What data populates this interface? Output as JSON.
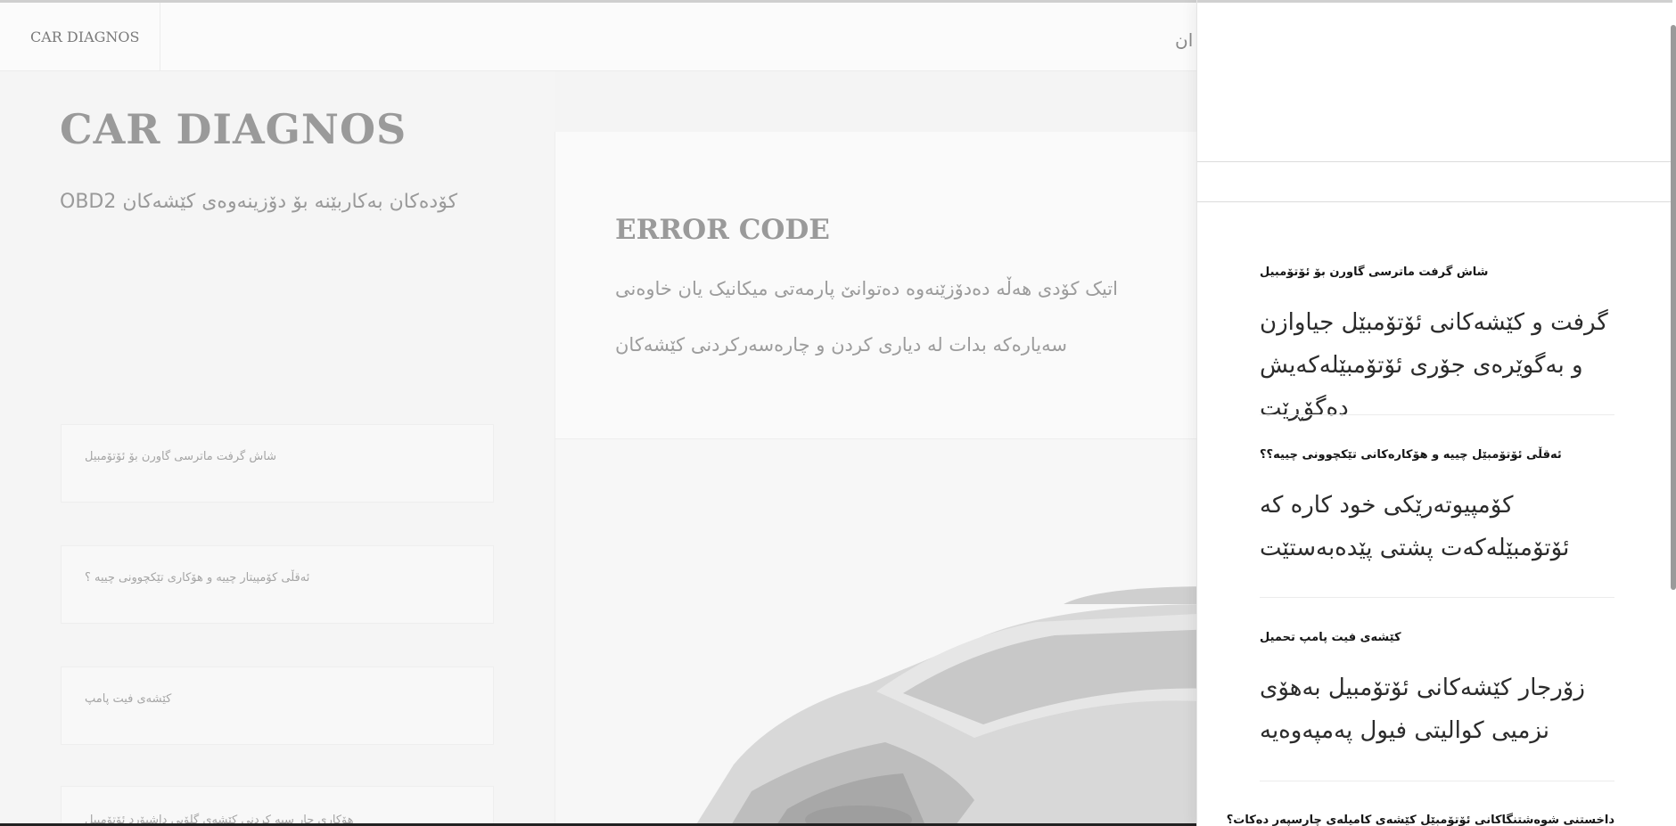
{
  "navbar": {
    "brand": "CAR DIAGNOS",
    "partial_link": "ان"
  },
  "hero": {
    "title": "CAR DIAGNOS",
    "subtitle": "کۆدەکان بەکاربێنە بۆ دۆزینەوەی کێشەکان OBD2"
  },
  "sidebar_cards": [
    "شاش گرفت ماترسی گاورن بۆ ئۆتۆمبیل",
    "ئەقڵی کۆمپیتار چییە و هۆکاری تێکچوونی چییە ؟",
    "کێشەی فیت پامپ",
    "هۆکاری چار سپە کردنی کێشەی گلۆبی داشبۆرد ئۆتۆمبیل"
  ],
  "error_section": {
    "title": "ERROR CODE",
    "description": "اتیک کۆدی هەڵە دەدۆزێنەوە دەتوانێ پارمەتی میکانیک یان خاوەنی سەیارەکە بدات لە دیاری کردن و چارەسەرکردنی کێشەکان"
  },
  "faq": [
    {
      "question": "شاش گرفت ماترسی گاورن بۆ ئۆتۆمبیل",
      "answer": "گرفت و کێشەکانی ئۆتۆمبێل جیاوازن و بەگوێرەی جۆری ئۆتۆمبێلەکەیش دەگۆڕێت"
    },
    {
      "question": "ئەقڵی ئۆتۆمبێل چییە و هۆکارەکانی تێکچوونی چییە؟؟",
      "answer": "کۆمپیوتەرێکی خود کارە کە ئۆتۆمبێلەکەت پشتی پێدەبەستێت"
    },
    {
      "question": "کێشەی فیت پامپ تحمیل",
      "answer": "زۆرجار کێشەکانی ئۆتۆمبیل بەهۆی نزمیی کوالیتی فیول پەمپەوەیە"
    },
    {
      "question": "داخستنی شوەشتنگاکانی ئۆتۆمبێل کێشەی کامیلەی چارسپەر دەکات؟",
      "answer": ""
    }
  ],
  "colors": {
    "page_background": "#f4f4f4",
    "overlay_background": "#ffffff",
    "faint_text": "#9a9a9a",
    "answer_text": "#2b2b2b"
  }
}
